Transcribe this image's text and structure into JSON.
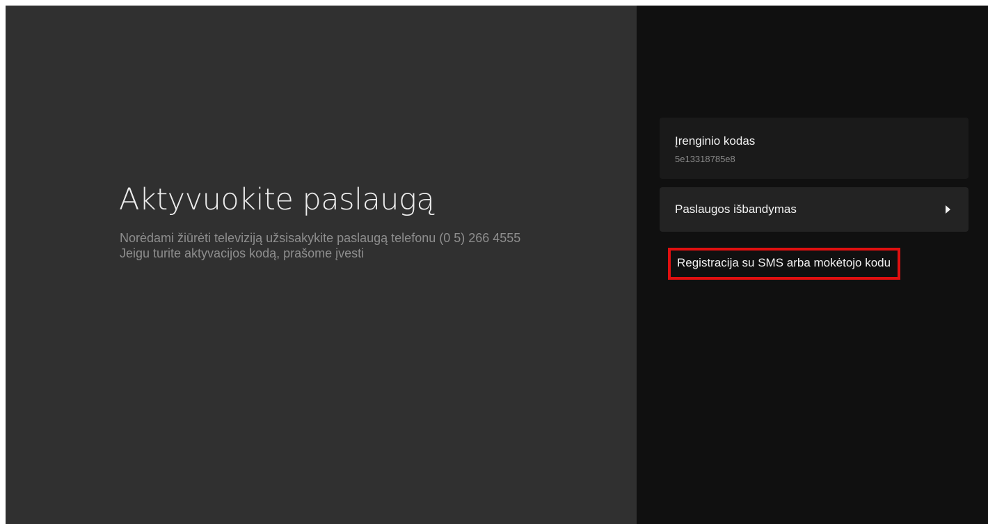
{
  "main": {
    "title": "Aktyvuokite paslaugą",
    "description_line1": "Norėdami žiūrėti televiziją užsisakykite paslaugą telefonu (0 5) 266 4555",
    "description_line2": "Jeigu turite aktyvacijos kodą, prašome įvesti"
  },
  "sidebar": {
    "device_code": {
      "label": "Įrenginio kodas",
      "value": "5e13318785e8"
    },
    "trial": {
      "label": "Paslaugos išbandymas",
      "icon": "chevron-right-icon"
    },
    "sms_registration": {
      "label": "Registracija su SMS arba mokėtojo kodu",
      "highlight_color": "#e01010"
    }
  },
  "colors": {
    "left_background": "#303030",
    "right_background": "#101010",
    "card_background": "#1a1a1a",
    "action_card_background": "#232323",
    "primary_text": "#f2f2f2",
    "secondary_text": "#8e8e8e",
    "highlight": "#e01010"
  }
}
